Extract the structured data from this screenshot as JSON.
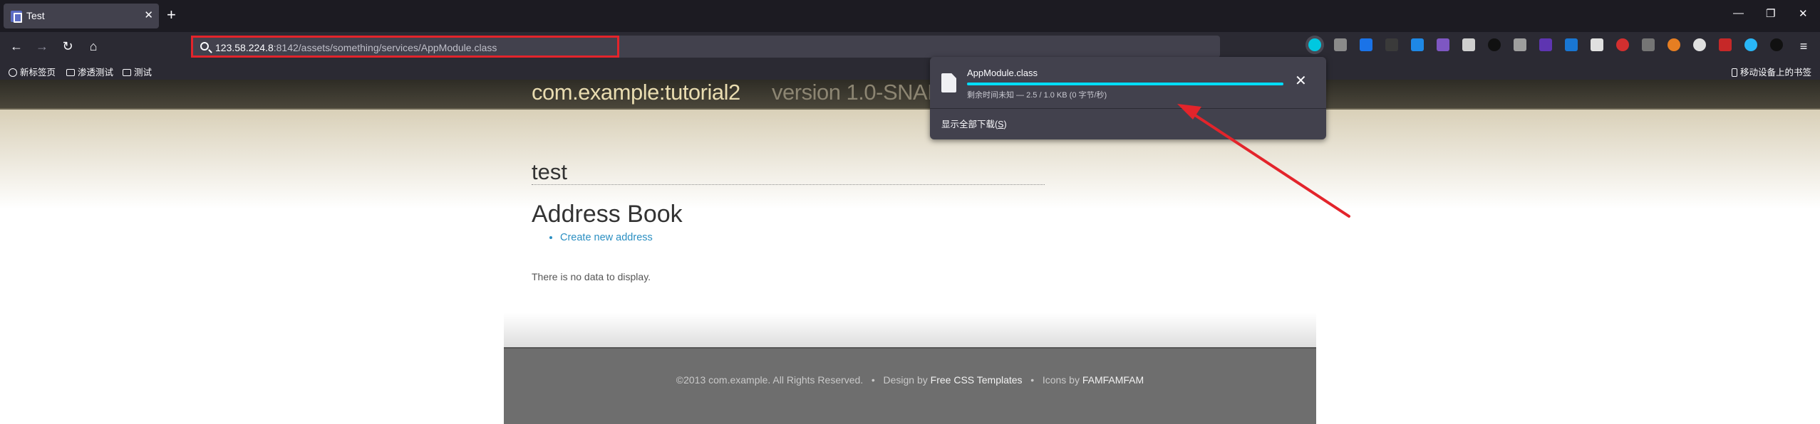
{
  "tab": {
    "title": "Test",
    "close": "✕"
  },
  "newtab": "+",
  "window": {
    "minimize": "—",
    "restore": "❐",
    "close": "✕"
  },
  "nav": {
    "back": "←",
    "forward": "→",
    "reload": "↻",
    "home": "⌂",
    "menu": "≡"
  },
  "url": {
    "host": "123.58.224.8",
    "rest": ":8142/assets/something/services/AppModule.class"
  },
  "bookmarks": {
    "items": [
      "新标签页",
      "渗透测试",
      "测试"
    ],
    "mobile": "移动设备上的书签"
  },
  "site": {
    "title": "com.example:tutorial2",
    "version": "version 1.0-SNAPSHOT",
    "post_title": "test",
    "section_title": "Address Book",
    "create_link": "Create new address",
    "empty": "There is no data to display.",
    "footer": {
      "copyright": "©2013 com.example. All Rights Reserved.",
      "sep1": "•",
      "design_by": "Design by",
      "design_link": "Free CSS Templates",
      "sep2": "•",
      "icons_by": "Icons by",
      "icons_link": "FAMFAMFAM"
    }
  },
  "download": {
    "filename": "AppModule.class",
    "status": "剩余时间未知 — 2.5 / 1.0 KB (0 字节/秒)",
    "progress": 1.0,
    "close": "✕",
    "show_all_prefix": "显示全部下载(",
    "show_all_key": "S",
    "show_all_suffix": ")"
  },
  "colors": {
    "chrome_bg": "#1c1b22",
    "toolbar_bg": "#2b2a33",
    "urlbar_bg": "#42414d",
    "highlight_red": "#e3242b",
    "progress_cyan": "#00ddff",
    "link_blue": "#2b8fc2"
  },
  "icons": [
    "firefox-favicon",
    "back-icon",
    "forward-icon",
    "reload-icon",
    "home-icon",
    "search-icon",
    "globe-icon",
    "folder-icon",
    "file-icon",
    "close-icon",
    "menu-icon",
    "mobile-icon"
  ]
}
